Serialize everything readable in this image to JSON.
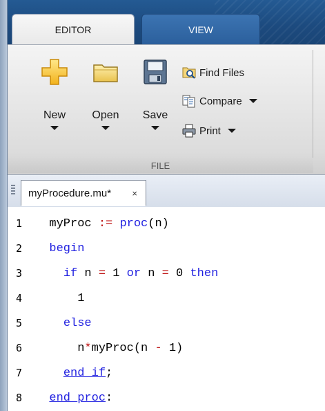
{
  "tabs": {
    "editor": "EDITOR",
    "view": "VIEW"
  },
  "ribbon": {
    "new_label": "New",
    "open_label": "Open",
    "save_label": "Save",
    "find_files_label": "Find Files",
    "compare_label": "Compare",
    "print_label": "Print",
    "group_label": "FILE"
  },
  "document_tab": {
    "name": "myProcedure.mu*",
    "close": "×"
  },
  "icons": [
    "new-plus-icon",
    "folder-icon",
    "floppy-disk-icon",
    "find-files-icon",
    "compare-icon",
    "printer-icon"
  ],
  "colors": {
    "keyword": "#1f1fe0",
    "operator": "#c01a1a",
    "text": "#000000"
  },
  "code_lines": [
    {
      "num": "1",
      "tokens": [
        {
          "t": "  myProc ",
          "c": "tx"
        },
        {
          "t": ":=",
          "c": "op"
        },
        {
          "t": " ",
          "c": "tx"
        },
        {
          "t": "proc",
          "c": "kw"
        },
        {
          "t": "(n)",
          "c": "tx"
        }
      ]
    },
    {
      "num": "2",
      "tokens": [
        {
          "t": "  ",
          "c": "tx"
        },
        {
          "t": "begin",
          "c": "kw"
        }
      ]
    },
    {
      "num": "3",
      "tokens": [
        {
          "t": "    ",
          "c": "tx"
        },
        {
          "t": "if",
          "c": "kw"
        },
        {
          "t": " n ",
          "c": "tx"
        },
        {
          "t": "=",
          "c": "op"
        },
        {
          "t": " 1 ",
          "c": "tx"
        },
        {
          "t": "or",
          "c": "kw"
        },
        {
          "t": " n ",
          "c": "tx"
        },
        {
          "t": "=",
          "c": "op"
        },
        {
          "t": " 0 ",
          "c": "tx"
        },
        {
          "t": "then",
          "c": "kw"
        }
      ]
    },
    {
      "num": "4",
      "tokens": [
        {
          "t": "      1",
          "c": "tx"
        }
      ]
    },
    {
      "num": "5",
      "tokens": [
        {
          "t": "    ",
          "c": "tx"
        },
        {
          "t": "else",
          "c": "kw"
        }
      ]
    },
    {
      "num": "6",
      "tokens": [
        {
          "t": "      n",
          "c": "tx"
        },
        {
          "t": "*",
          "c": "op"
        },
        {
          "t": "myProc(n ",
          "c": "tx"
        },
        {
          "t": "-",
          "c": "op"
        },
        {
          "t": " 1)",
          "c": "tx"
        }
      ]
    },
    {
      "num": "7",
      "tokens": [
        {
          "t": "    ",
          "c": "tx"
        },
        {
          "t": "end_if",
          "c": "kw ul"
        },
        {
          "t": ";",
          "c": "tx"
        }
      ]
    },
    {
      "num": "8",
      "tokens": [
        {
          "t": "  ",
          "c": "tx"
        },
        {
          "t": "end_proc",
          "c": "kw ul"
        },
        {
          "t": ":",
          "c": "tx"
        }
      ]
    }
  ]
}
